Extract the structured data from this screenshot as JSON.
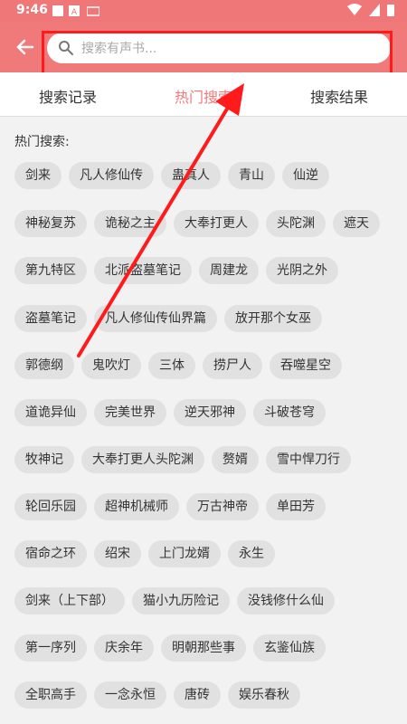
{
  "status": {
    "time": "9:46"
  },
  "search": {
    "placeholder": "搜索有声书..."
  },
  "tabs": [
    "搜索记录",
    "热门搜索",
    "搜索结果"
  ],
  "section_title": "热门搜索:",
  "hot_searches": [
    "剑来",
    "凡人修仙传",
    "蛊真人",
    "青山",
    "仙逆",
    "神秘复苏",
    "诡秘之主",
    "大奉打更人",
    "头陀渊",
    "遮天",
    "第九特区",
    "北派盗墓笔记",
    "周建龙",
    "光阴之外",
    "盗墓笔记",
    "凡人修仙传仙界篇",
    "放开那个女巫",
    "郭德纲",
    "鬼吹灯",
    "三体",
    "捞尸人",
    "吞噬星空",
    "道诡异仙",
    "完美世界",
    "逆天邪神",
    "斗破苍穹",
    "牧神记",
    "大奉打更人头陀渊",
    "赘婿",
    "雪中悍刀行",
    "轮回乐园",
    "超神机械师",
    "万古神帝",
    "单田芳",
    "宿命之环",
    "绍宋",
    "上门龙婿",
    "永生",
    "剑来（上下部）",
    "猫小九历险记",
    "没钱修什么仙",
    "第一序列",
    "庆余年",
    "明朝那些事",
    "玄鉴仙族",
    "全职高手",
    "一念永恒",
    "唐砖",
    "娱乐春秋"
  ],
  "colors": {
    "accent": "#f07a7a",
    "highlight": "#ff1b1b"
  }
}
